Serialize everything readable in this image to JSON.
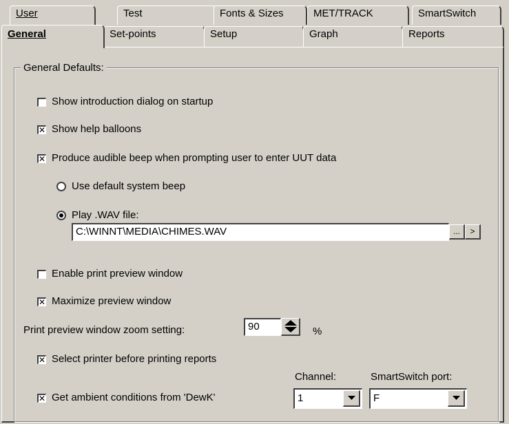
{
  "tabs_back": [
    {
      "label": "User",
      "key": "U"
    },
    {
      "label": "Test",
      "key": "e"
    },
    {
      "label": "Fonts & Sizes",
      "key": "F"
    },
    {
      "label": "MET/TRACK",
      "key": "M"
    },
    {
      "label": "SmartSwitch",
      "key": ""
    }
  ],
  "tabs_front": [
    {
      "label": "General"
    },
    {
      "label": "Set-points"
    },
    {
      "label": "Setup"
    },
    {
      "label": "Graph"
    },
    {
      "label": "Reports"
    }
  ],
  "group": {
    "title": "General Defaults:"
  },
  "options": {
    "show_intro": {
      "label": "Show introduction dialog on startup",
      "checked": false
    },
    "show_help": {
      "label": "Show help balloons",
      "checked": true
    },
    "audible_beep": {
      "label": "Produce audible beep when prompting user to enter UUT data",
      "checked": true
    },
    "default_beep": {
      "label": "Use default system beep",
      "selected": false
    },
    "play_wav": {
      "label": "Play .WAV file:",
      "selected": true
    },
    "print_preview": {
      "label": "Enable print preview window",
      "checked": false
    },
    "maximize_preview": {
      "label": "Maximize preview window",
      "checked": true
    },
    "select_printer": {
      "label": "Select printer before printing reports",
      "checked": true
    },
    "ambient": {
      "label": "Get ambient conditions from 'DewK'",
      "checked": true
    }
  },
  "wav_path": {
    "value": "C:\\WINNT\\MEDIA\\CHIMES.WAV",
    "browse_label": "...",
    "play_label": ">"
  },
  "zoom": {
    "label": "Print preview window zoom setting:",
    "value": "90",
    "unit": "%"
  },
  "channel": {
    "label": "Channel:",
    "value": "1"
  },
  "smartswitch_port": {
    "label": "SmartSwitch port:",
    "value": "F"
  },
  "check_mark": "✕"
}
